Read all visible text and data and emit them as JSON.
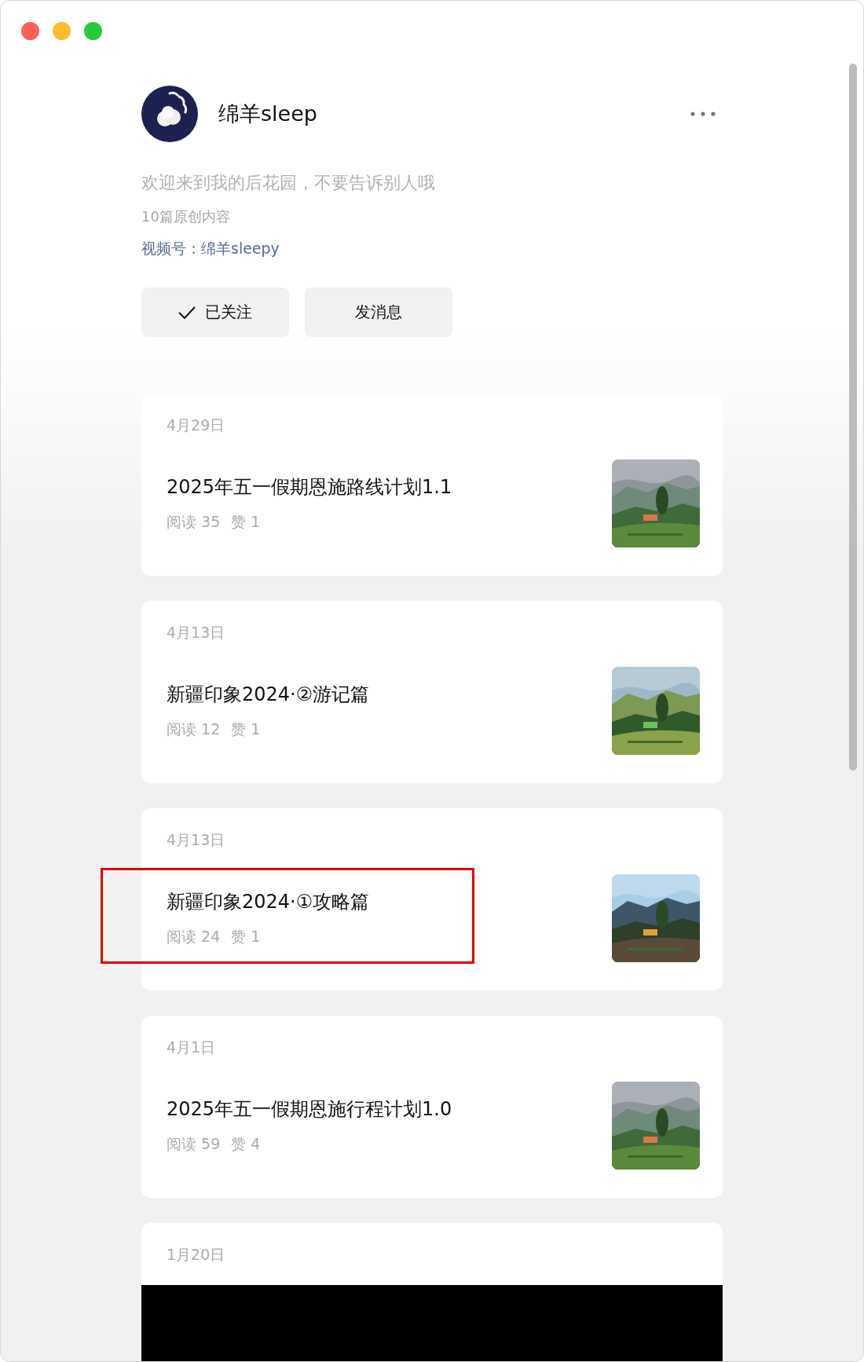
{
  "profile": {
    "name": "绵羊sleep",
    "bio": "欢迎来到我的后花园，不要告诉别人哦",
    "count": "10篇原创内容",
    "channel": "视频号：绵羊sleepy"
  },
  "buttons": [
    {
      "kind": "followed",
      "label": "已关注"
    },
    {
      "kind": "message",
      "label": "发消息"
    }
  ],
  "posts": [
    {
      "kind": "article",
      "date": "4月29日",
      "title": "2025年五一假期恩施路线计划1.1",
      "reads": "阅读 35",
      "likes": "赞 1",
      "highlighted": false
    },
    {
      "kind": "article",
      "date": "4月13日",
      "title": "新疆印象2024·②游记篇",
      "reads": "阅读 12",
      "likes": "赞 1",
      "highlighted": false
    },
    {
      "kind": "article",
      "date": "4月13日",
      "title": "新疆印象2024·①攻略篇",
      "reads": "阅读 24",
      "likes": "赞 1",
      "highlighted": true
    },
    {
      "kind": "article",
      "date": "4月1日",
      "title": "2025年五一假期恩施行程计划1.0",
      "reads": "阅读 59",
      "likes": "赞 4",
      "highlighted": false
    },
    {
      "kind": "video",
      "date": "1月20日"
    }
  ]
}
